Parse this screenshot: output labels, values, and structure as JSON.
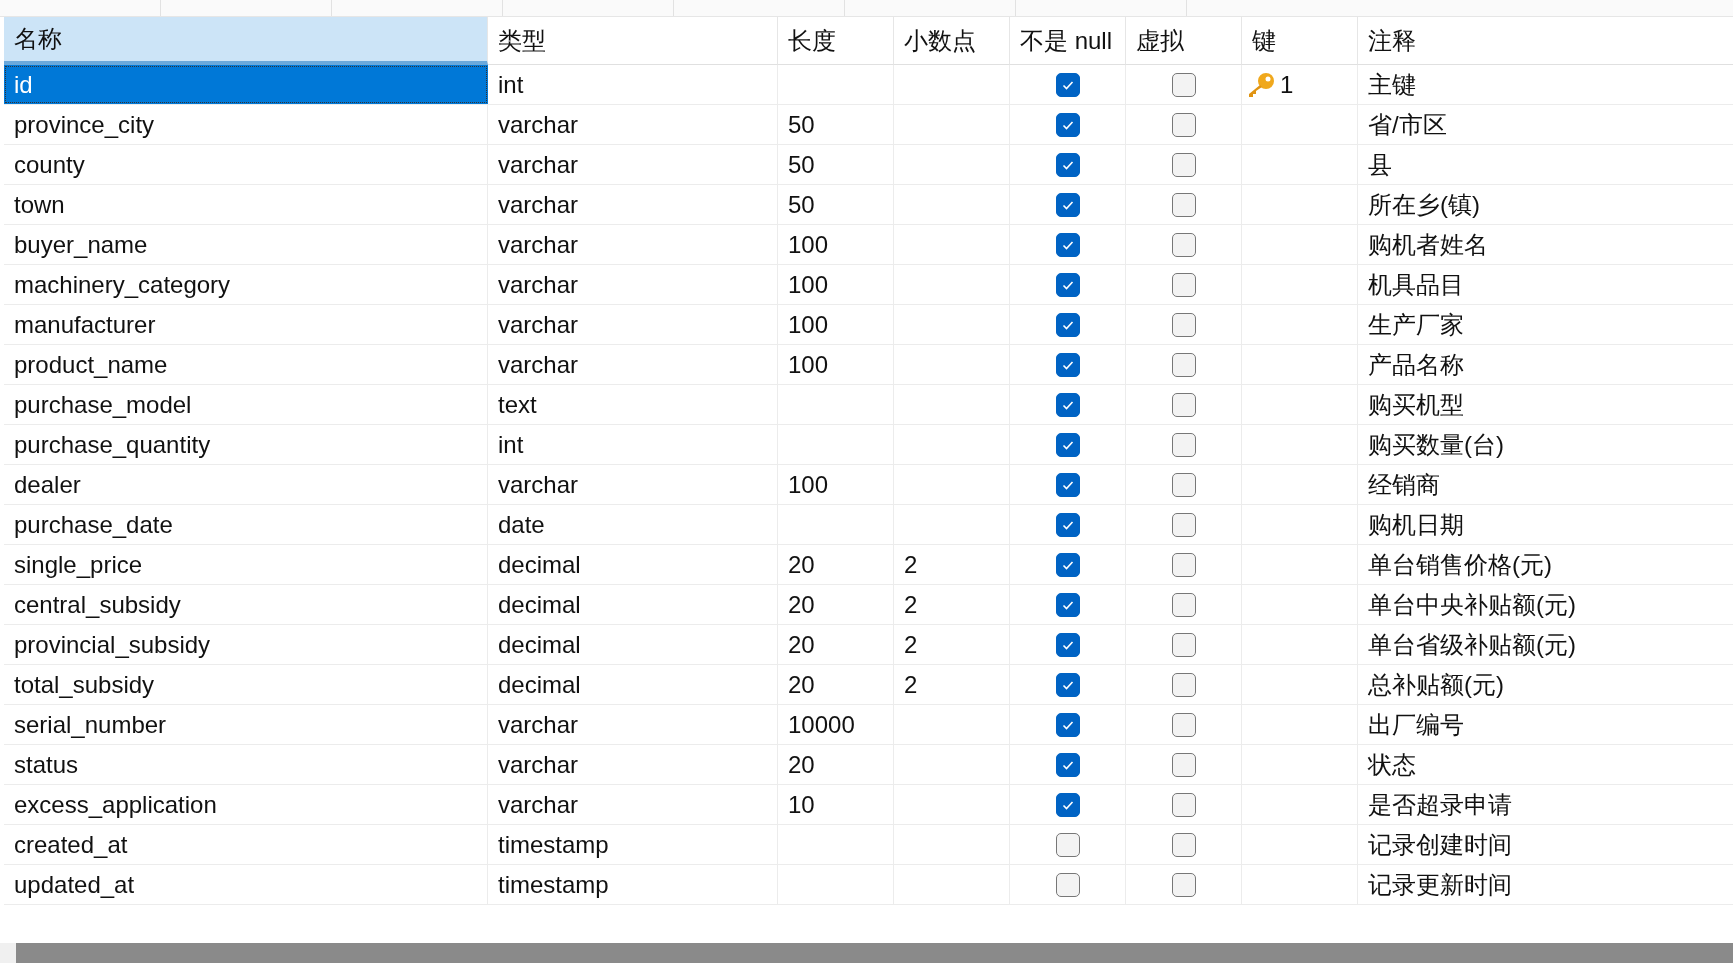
{
  "table": {
    "columns": [
      {
        "label": "名称",
        "selected": true
      },
      {
        "label": "类型",
        "selected": false
      },
      {
        "label": "长度",
        "selected": false
      },
      {
        "label": "小数点",
        "selected": false
      },
      {
        "label": "不是 null",
        "selected": false
      },
      {
        "label": "虚拟",
        "selected": false
      },
      {
        "label": "键",
        "selected": false
      },
      {
        "label": "注释",
        "selected": false
      }
    ],
    "rows": [
      {
        "name": "id",
        "type": "int",
        "length": "",
        "decimals": "",
        "not_null": true,
        "virtual": false,
        "key": "1",
        "comment": "主键",
        "selected": true
      },
      {
        "name": "province_city",
        "type": "varchar",
        "length": "50",
        "decimals": "",
        "not_null": true,
        "virtual": false,
        "comment": "省/市区",
        "selected": false
      },
      {
        "name": "county",
        "type": "varchar",
        "length": "50",
        "decimals": "",
        "not_null": true,
        "virtual": false,
        "comment": "县",
        "selected": false
      },
      {
        "name": "town",
        "type": "varchar",
        "length": "50",
        "decimals": "",
        "not_null": true,
        "virtual": false,
        "comment": "所在乡(镇)",
        "selected": false
      },
      {
        "name": "buyer_name",
        "type": "varchar",
        "length": "100",
        "decimals": "",
        "not_null": true,
        "virtual": false,
        "comment": "购机者姓名",
        "selected": false
      },
      {
        "name": "machinery_category",
        "type": "varchar",
        "length": "100",
        "decimals": "",
        "not_null": true,
        "virtual": false,
        "comment": "机具品目",
        "selected": false
      },
      {
        "name": "manufacturer",
        "type": "varchar",
        "length": "100",
        "decimals": "",
        "not_null": true,
        "virtual": false,
        "comment": "生产厂家",
        "selected": false
      },
      {
        "name": "product_name",
        "type": "varchar",
        "length": "100",
        "decimals": "",
        "not_null": true,
        "virtual": false,
        "comment": "产品名称",
        "selected": false
      },
      {
        "name": "purchase_model",
        "type": "text",
        "length": "",
        "decimals": "",
        "not_null": true,
        "virtual": false,
        "comment": "购买机型",
        "selected": false
      },
      {
        "name": "purchase_quantity",
        "type": "int",
        "length": "",
        "decimals": "",
        "not_null": true,
        "virtual": false,
        "comment": "购买数量(台)",
        "selected": false
      },
      {
        "name": "dealer",
        "type": "varchar",
        "length": "100",
        "decimals": "",
        "not_null": true,
        "virtual": false,
        "comment": "经销商",
        "selected": false
      },
      {
        "name": "purchase_date",
        "type": "date",
        "length": "",
        "decimals": "",
        "not_null": true,
        "virtual": false,
        "comment": "购机日期",
        "selected": false
      },
      {
        "name": "single_price",
        "type": "decimal",
        "length": "20",
        "decimals": "2",
        "not_null": true,
        "virtual": false,
        "comment": "单台销售价格(元)",
        "selected": false
      },
      {
        "name": "central_subsidy",
        "type": "decimal",
        "length": "20",
        "decimals": "2",
        "not_null": true,
        "virtual": false,
        "comment": "单台中央补贴额(元)",
        "selected": false
      },
      {
        "name": "provincial_subsidy",
        "type": "decimal",
        "length": "20",
        "decimals": "2",
        "not_null": true,
        "virtual": false,
        "comment": "单台省级补贴额(元)",
        "selected": false
      },
      {
        "name": "total_subsidy",
        "type": "decimal",
        "length": "20",
        "decimals": "2",
        "not_null": true,
        "virtual": false,
        "comment": "总补贴额(元)",
        "selected": false
      },
      {
        "name": "serial_number",
        "type": "varchar",
        "length": "10000",
        "decimals": "",
        "not_null": true,
        "virtual": false,
        "comment": "出厂编号",
        "selected": false
      },
      {
        "name": "status",
        "type": "varchar",
        "length": "20",
        "decimals": "",
        "not_null": true,
        "virtual": false,
        "comment": "状态",
        "selected": false
      },
      {
        "name": "excess_application",
        "type": "varchar",
        "length": "10",
        "decimals": "",
        "not_null": true,
        "virtual": false,
        "comment": "是否超录申请",
        "selected": false
      },
      {
        "name": "created_at",
        "type": "timestamp",
        "length": "",
        "decimals": "",
        "not_null": false,
        "virtual": false,
        "comment": "记录创建时间",
        "selected": false
      },
      {
        "name": "updated_at",
        "type": "timestamp",
        "length": "",
        "decimals": "",
        "not_null": false,
        "virtual": false,
        "comment": "记录更新时间",
        "selected": false
      }
    ]
  }
}
